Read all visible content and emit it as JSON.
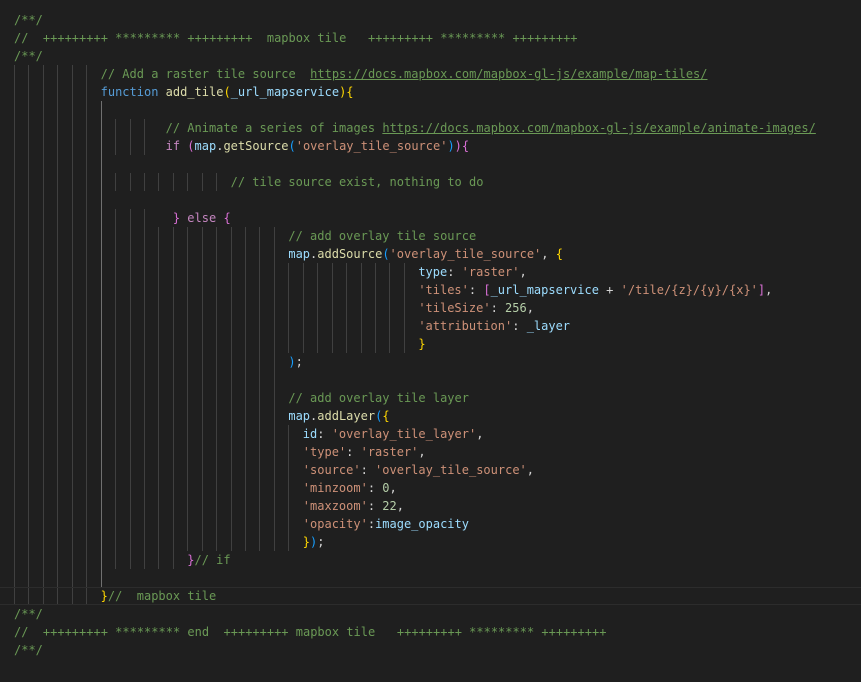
{
  "editor": {
    "theme_colors": {
      "background": "#1f1f1f",
      "comment": "#6a9955",
      "keyword": "#569cd6",
      "control": "#c586c0",
      "function": "#dcdcaa",
      "variable": "#9cdcfe",
      "string": "#ce9178",
      "number": "#b5cea8"
    },
    "current_line": 32,
    "lines": [
      {
        "indent": 0,
        "tokens": [
          [
            "cm",
            "/**/"
          ]
        ]
      },
      {
        "indent": 0,
        "tokens": [
          [
            "cm",
            "//  +++++++++ ********* +++++++++  mapbox tile   +++++++++ ********* +++++++++"
          ]
        ]
      },
      {
        "indent": 0,
        "tokens": [
          [
            "cm",
            "/**/"
          ]
        ]
      },
      {
        "indent": 12,
        "tokens": [
          [
            "cm",
            "// Add a raster tile source  "
          ],
          [
            "ln",
            "https://docs.mapbox.com/mapbox-gl-js/example/map-tiles/"
          ]
        ]
      },
      {
        "indent": 12,
        "tokens": [
          [
            "kw",
            "function"
          ],
          [
            "p",
            " "
          ],
          [
            "fn",
            "add_tile"
          ],
          [
            "b1",
            "("
          ],
          [
            "var",
            "_url_mapservice"
          ],
          [
            "b1",
            ")"
          ],
          [
            "b1",
            "{"
          ]
        ]
      },
      {
        "indent": 13,
        "tokens": []
      },
      {
        "indent": 21,
        "tokens": [
          [
            "cm",
            "// Animate a series of images "
          ],
          [
            "ln",
            "https://docs.mapbox.com/mapbox-gl-js/example/animate-images/"
          ]
        ]
      },
      {
        "indent": 21,
        "tokens": [
          [
            "ctl",
            "if"
          ],
          [
            "p",
            " "
          ],
          [
            "b2",
            "("
          ],
          [
            "var",
            "map"
          ],
          [
            "p",
            "."
          ],
          [
            "fn",
            "getSource"
          ],
          [
            "b3",
            "("
          ],
          [
            "str",
            "'overlay_tile_source'"
          ],
          [
            "b3",
            ")"
          ],
          [
            "b2",
            ")"
          ],
          [
            "b2",
            "{"
          ]
        ]
      },
      {
        "indent": 13,
        "tokens": []
      },
      {
        "indent": 30,
        "tokens": [
          [
            "cm",
            "// tile source exist, nothing to do"
          ]
        ]
      },
      {
        "indent": 13,
        "tokens": []
      },
      {
        "indent": 21,
        "tokens": [
          [
            "p",
            " "
          ],
          [
            "b2",
            "}"
          ],
          [
            "ctl",
            " else "
          ],
          [
            "b2",
            "{"
          ]
        ]
      },
      {
        "indent": 38,
        "tokens": [
          [
            "cm",
            "// add overlay tile source"
          ]
        ]
      },
      {
        "indent": 38,
        "tokens": [
          [
            "var",
            "map"
          ],
          [
            "p",
            "."
          ],
          [
            "fn",
            "addSource"
          ],
          [
            "b3",
            "("
          ],
          [
            "str",
            "'overlay_tile_source'"
          ],
          [
            "p",
            ", "
          ],
          [
            "b1",
            "{"
          ]
        ]
      },
      {
        "indent": 56,
        "tokens": [
          [
            "var",
            "type"
          ],
          [
            "p",
            ": "
          ],
          [
            "str",
            "'raster'"
          ],
          [
            "p",
            ","
          ]
        ]
      },
      {
        "indent": 56,
        "tokens": [
          [
            "str",
            "'tiles'"
          ],
          [
            "p",
            ": "
          ],
          [
            "b2",
            "["
          ],
          [
            "var",
            "_url_mapservice"
          ],
          [
            "p",
            " + "
          ],
          [
            "str",
            "'/tile/{z}/{y}/{x}'"
          ],
          [
            "b2",
            "]"
          ],
          [
            "p",
            ","
          ]
        ]
      },
      {
        "indent": 56,
        "tokens": [
          [
            "str",
            "'tileSize'"
          ],
          [
            "p",
            ": "
          ],
          [
            "num",
            "256"
          ],
          [
            "p",
            ","
          ]
        ]
      },
      {
        "indent": 56,
        "tokens": [
          [
            "str",
            "'attribution'"
          ],
          [
            "p",
            ": "
          ],
          [
            "var",
            "_layer"
          ]
        ]
      },
      {
        "indent": 56,
        "tokens": [
          [
            "b1",
            "}"
          ]
        ]
      },
      {
        "indent": 38,
        "tokens": [
          [
            "b3",
            ")"
          ],
          [
            "p",
            ";"
          ]
        ]
      },
      {
        "indent": 37,
        "tokens": []
      },
      {
        "indent": 38,
        "tokens": [
          [
            "cm",
            "// add overlay tile layer"
          ]
        ]
      },
      {
        "indent": 38,
        "tokens": [
          [
            "var",
            "map"
          ],
          [
            "p",
            "."
          ],
          [
            "fn",
            "addLayer"
          ],
          [
            "b3",
            "("
          ],
          [
            "b1",
            "{"
          ]
        ]
      },
      {
        "indent": 40,
        "tokens": [
          [
            "var",
            "id"
          ],
          [
            "p",
            ": "
          ],
          [
            "str",
            "'overlay_tile_layer'"
          ],
          [
            "p",
            ","
          ]
        ]
      },
      {
        "indent": 40,
        "tokens": [
          [
            "str",
            "'type'"
          ],
          [
            "p",
            ": "
          ],
          [
            "str",
            "'raster'"
          ],
          [
            "p",
            ","
          ]
        ]
      },
      {
        "indent": 40,
        "tokens": [
          [
            "str",
            "'source'"
          ],
          [
            "p",
            ": "
          ],
          [
            "str",
            "'overlay_tile_source'"
          ],
          [
            "p",
            ","
          ]
        ]
      },
      {
        "indent": 40,
        "tokens": [
          [
            "str",
            "'minzoom'"
          ],
          [
            "p",
            ": "
          ],
          [
            "num",
            "0"
          ],
          [
            "p",
            ","
          ]
        ]
      },
      {
        "indent": 40,
        "tokens": [
          [
            "str",
            "'maxzoom'"
          ],
          [
            "p",
            ": "
          ],
          [
            "num",
            "22"
          ],
          [
            "p",
            ","
          ]
        ]
      },
      {
        "indent": 40,
        "tokens": [
          [
            "str",
            "'opacity'"
          ],
          [
            "p",
            ":"
          ],
          [
            "var",
            "image_opacity"
          ]
        ]
      },
      {
        "indent": 40,
        "tokens": [
          [
            "b1",
            "}"
          ],
          [
            "b3",
            ")"
          ],
          [
            "p",
            ";"
          ]
        ]
      },
      {
        "indent": 24,
        "tokens": [
          [
            "b2",
            "}"
          ],
          [
            "cm",
            "// if"
          ]
        ]
      },
      {
        "indent": 13,
        "tokens": []
      },
      {
        "indent": 12,
        "tokens": [
          [
            "b1",
            "}"
          ],
          [
            "cm",
            "//  mapbox tile"
          ]
        ]
      },
      {
        "indent": 0,
        "tokens": [
          [
            "cm",
            "/**/"
          ]
        ]
      },
      {
        "indent": 0,
        "tokens": [
          [
            "cm",
            "//  +++++++++ ********* end  +++++++++ mapbox tile   +++++++++ ********* +++++++++"
          ]
        ]
      },
      {
        "indent": 0,
        "tokens": [
          [
            "cm",
            "/**/"
          ]
        ]
      }
    ]
  }
}
